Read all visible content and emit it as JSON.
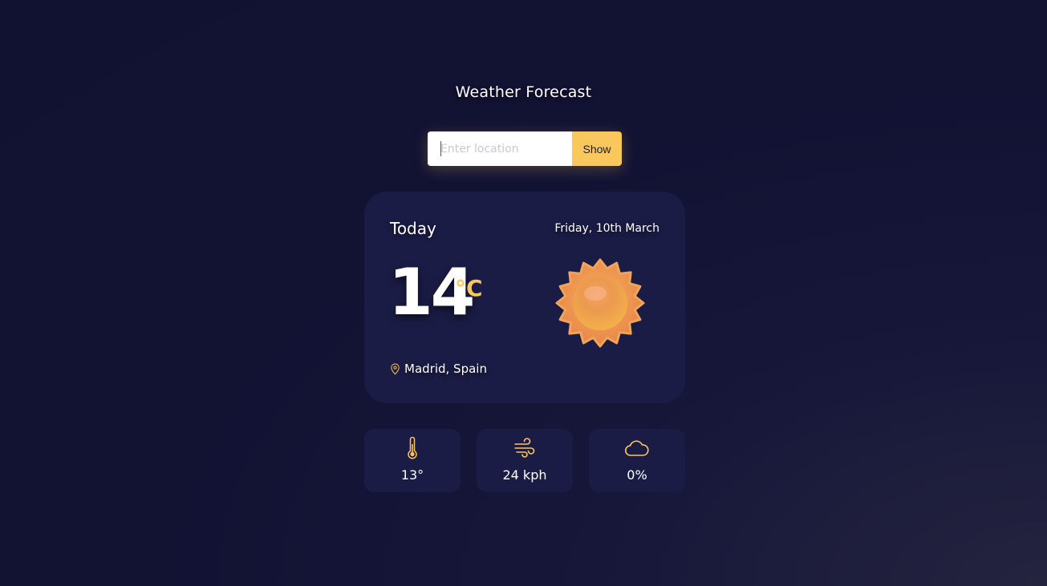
{
  "header": {
    "title": "Weather Forecast"
  },
  "search": {
    "placeholder": "Enter location",
    "value": "",
    "button_label": "Show"
  },
  "current": {
    "day_label": "Today",
    "date": "Friday, 10th March",
    "temperature": "14",
    "unit": "°C",
    "condition_icon": "sun-icon",
    "location": "Madrid, Spain",
    "location_icon": "map-pin-icon"
  },
  "stats": [
    {
      "icon": "thermometer-icon",
      "value": "13°"
    },
    {
      "icon": "wind-icon",
      "value": "24 kph"
    },
    {
      "icon": "cloud-icon",
      "value": "0%"
    }
  ],
  "colors": {
    "background": "#121233",
    "card": "#1b1c45",
    "accent": "#f9c75c",
    "text": "#ffffff"
  }
}
